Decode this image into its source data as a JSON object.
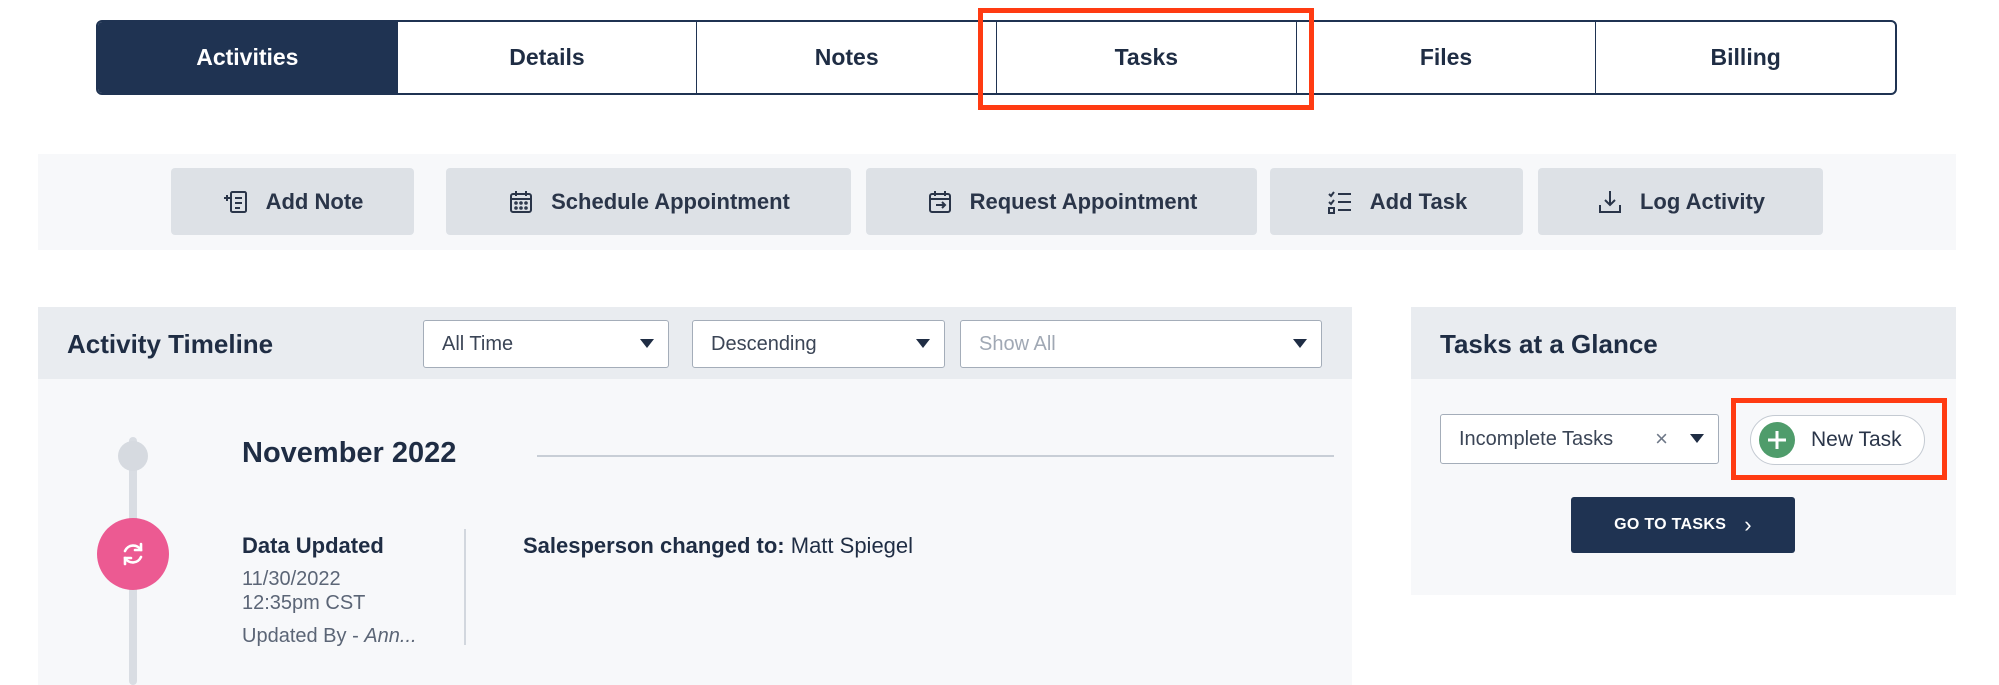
{
  "tabs": [
    {
      "label": "Activities",
      "active": true
    },
    {
      "label": "Details",
      "active": false
    },
    {
      "label": "Notes",
      "active": false
    },
    {
      "label": "Tasks",
      "active": false
    },
    {
      "label": "Files",
      "active": false
    },
    {
      "label": "Billing",
      "active": false
    }
  ],
  "actions": [
    {
      "label": "Add Note",
      "icon": "add-note-icon"
    },
    {
      "label": "Schedule Appointment",
      "icon": "calendar-icon"
    },
    {
      "label": "Request Appointment",
      "icon": "calendar-arrow-icon"
    },
    {
      "label": "Add Task",
      "icon": "checklist-icon"
    },
    {
      "label": "Log Activity",
      "icon": "download-icon"
    }
  ],
  "timeline": {
    "title": "Activity Timeline",
    "filters": {
      "time": "All Time",
      "order": "Descending",
      "show_placeholder": "Show All"
    },
    "month": "November 2022",
    "event": {
      "title": "Data Updated",
      "date": "11/30/2022",
      "time": "12:35pm CST",
      "updated_by_prefix": "Updated By -",
      "updated_by_name": "Ann...",
      "desc_label": "Salesperson changed to:",
      "desc_value": "Matt Spiegel",
      "icon": "refresh-icon"
    }
  },
  "tasks_glance": {
    "title": "Tasks at a Glance",
    "filter_value": "Incomplete Tasks",
    "clear_symbol": "×",
    "new_task_label": "New Task",
    "go_label": "GO TO TASKS",
    "go_arrow": "›"
  },
  "colors": {
    "navy": "#1f3352",
    "highlight": "#ff3b12",
    "event_pink": "#ec5a92",
    "plus_green": "#4f9c6b"
  }
}
